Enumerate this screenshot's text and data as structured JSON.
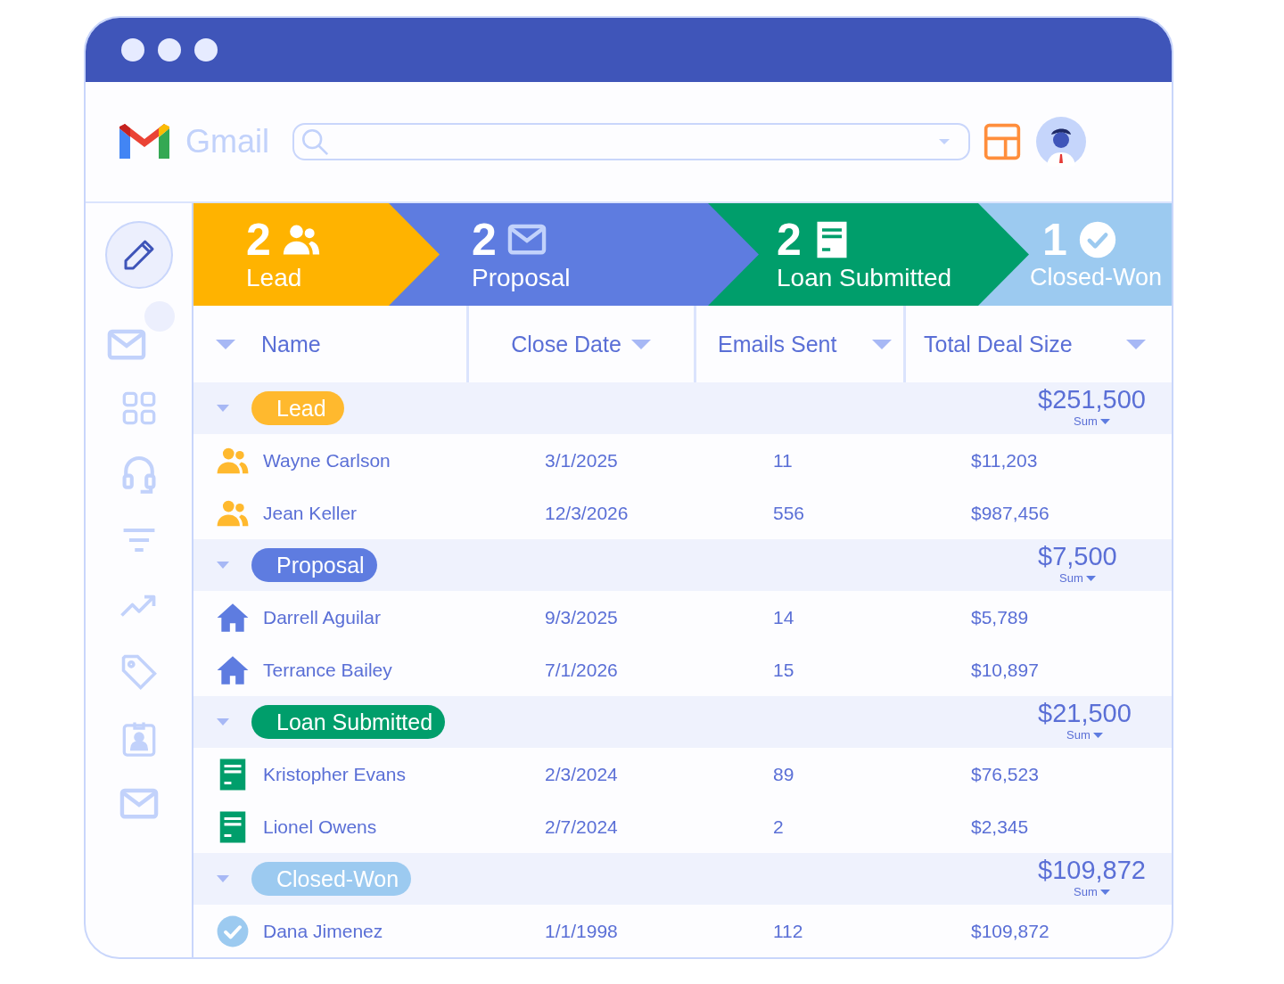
{
  "app": {
    "name": "Gmail"
  },
  "sidebar": {
    "items": [
      {
        "kind": "pencil",
        "selected": true,
        "badge": false
      },
      {
        "kind": "mail",
        "selected": false,
        "badge": true
      },
      {
        "kind": "grid",
        "selected": false,
        "badge": false
      },
      {
        "kind": "headset",
        "selected": false,
        "badge": false
      },
      {
        "kind": "filter",
        "selected": false,
        "badge": false
      },
      {
        "kind": "trend",
        "selected": false,
        "badge": false
      },
      {
        "kind": "tag",
        "selected": false,
        "badge": false
      },
      {
        "kind": "id-card",
        "selected": false,
        "badge": false
      },
      {
        "kind": "mail",
        "selected": false,
        "badge": false
      }
    ]
  },
  "pipeline": [
    {
      "count": "2",
      "label": "Lead",
      "kind": "people",
      "color": "#ffb300"
    },
    {
      "count": "2",
      "label": "Proposal",
      "kind": "mail",
      "color": "#5e7ce0"
    },
    {
      "count": "2",
      "label": "Loan Submitted",
      "kind": "document",
      "color": "#009e6b"
    },
    {
      "count": "1",
      "label": "Closed-Won",
      "kind": "check",
      "color": "#9ccaf0"
    }
  ],
  "table": {
    "columns": [
      {
        "label": "Name"
      },
      {
        "label": "Close Date"
      },
      {
        "label": "Emails Sent"
      },
      {
        "label": "Total Deal Size"
      }
    ],
    "groups": [
      {
        "label": "Lead",
        "color": "#ffb92e",
        "kind": "people",
        "sum": "$251,500",
        "sum_label": "Sum",
        "expanded": true,
        "rows": [
          {
            "name": "Wayne Carlson",
            "close_date": "3/1/2025",
            "emails_sent": "11",
            "total": "$11,203"
          },
          {
            "name": "Jean Keller",
            "close_date": "12/3/2026",
            "emails_sent": "556",
            "total": "$987,456"
          }
        ]
      },
      {
        "label": "Proposal",
        "color": "#5e7ce0",
        "kind": "house",
        "sum": "$7,500",
        "sum_label": "Sum",
        "expanded": true,
        "rows": [
          {
            "name": "Darrell Aguilar",
            "close_date": "9/3/2025",
            "emails_sent": "14",
            "total": "$5,789"
          },
          {
            "name": "Terrance Bailey",
            "close_date": "7/1/2026",
            "emails_sent": "15",
            "total": "$10,897"
          }
        ]
      },
      {
        "label": "Loan Submitted",
        "color": "#009e6b",
        "kind": "document",
        "sum": "$21,500",
        "sum_label": "Sum",
        "expanded": true,
        "rows": [
          {
            "name": "Kristopher Evans",
            "close_date": "2/3/2024",
            "emails_sent": "89",
            "total": "$76,523"
          },
          {
            "name": "Lionel Owens",
            "close_date": "2/7/2024",
            "emails_sent": "2",
            "total": "$2,345"
          }
        ]
      },
      {
        "label": "Closed-Won",
        "color": "#9ccaf0",
        "kind": "check",
        "sum": "$109,872",
        "sum_label": "Sum",
        "expanded": true,
        "rows": [
          {
            "name": "Dana Jimenez",
            "close_date": "1/1/1998",
            "emails_sent": "112",
            "total": "$109,872"
          }
        ]
      }
    ]
  }
}
